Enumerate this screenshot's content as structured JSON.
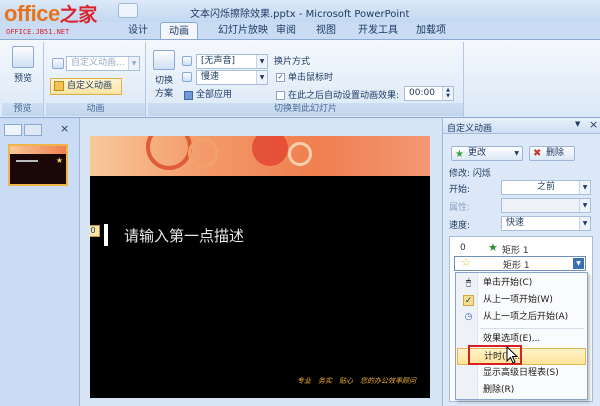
{
  "window": {
    "title": "文本闪烁擦除效果.pptx - Microsoft PowerPoint"
  },
  "logo": {
    "brand": "office",
    "brand_cn": "之家",
    "domain": "OFFICE.JB51.NET"
  },
  "ribbon_tabs": [
    {
      "label": "设计"
    },
    {
      "label": "动画",
      "active": true
    },
    {
      "label": "幻灯片放映"
    },
    {
      "label": "审阅"
    },
    {
      "label": "视图"
    },
    {
      "label": "开发工具"
    },
    {
      "label": "加载项"
    }
  ],
  "ribbon": {
    "preview": {
      "button": "预览",
      "group": "预览"
    },
    "animation": {
      "combo_placeholder": "自定义动画...",
      "custom_button": "自定义动画",
      "group": "动画"
    },
    "transition": {
      "scheme_button_line1": "切换",
      "scheme_button_line2": "方案",
      "sound_value": "[无声音]",
      "speed_value": "慢速",
      "apply_all": "全部应用",
      "advance_heading": "换片方式",
      "on_click_label": "单击鼠标时",
      "on_click_checked": true,
      "after_label": "在此之后自动设置动画效果:",
      "after_checked": false,
      "after_time": "00:00",
      "group": "切换到此幻灯片"
    }
  },
  "slide": {
    "tag": "0",
    "bullet_text": "请输入第一点描述",
    "footer": "专业　务实　贴心　您的办公效率顾问"
  },
  "task_pane": {
    "title": "自定义动画",
    "change_button": "更改",
    "delete_button": "删除",
    "modify_label": "修改: 闪烁",
    "start_label": "开始:",
    "start_value": "之前",
    "property_label": "属性:",
    "speed_label": "速度:",
    "speed_value": "快速",
    "items": [
      {
        "index": "0",
        "name": "矩形 1"
      },
      {
        "index": "",
        "name": "矩形 1"
      }
    ]
  },
  "context_menu": {
    "items": [
      {
        "label": "单击开始(C)",
        "icon": "mouse-icon"
      },
      {
        "label": "从上一项开始(W)",
        "icon": "check-icon"
      },
      {
        "label": "从上一项之后开始(A)",
        "icon": "clock-icon"
      },
      {
        "label": "效果选项(E)..."
      },
      {
        "label": "计时(T)...",
        "hover": true
      },
      {
        "label": "显示高级日程表(S)"
      },
      {
        "label": "删除(R)"
      }
    ]
  }
}
